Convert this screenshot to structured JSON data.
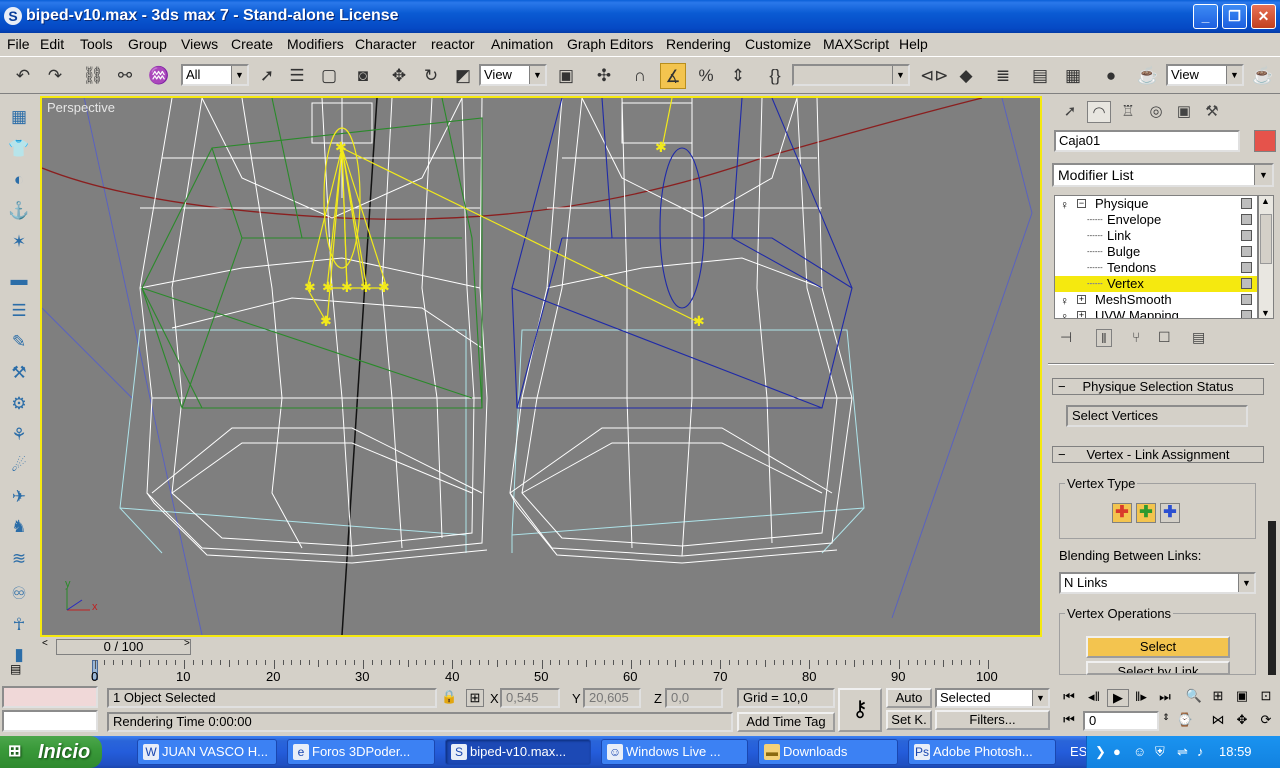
{
  "window": {
    "title": "biped-v10.max - 3ds max 7  - Stand-alone License",
    "app_icon": "3ds-max-icon",
    "controls": {
      "minimize": "_",
      "maximize": "❐",
      "close": "✕"
    }
  },
  "menu": [
    "File",
    "Edit",
    "Tools",
    "Group",
    "Views",
    "Create",
    "Modifiers",
    "Character",
    "reactor",
    "Animation",
    "Graph Editors",
    "Rendering",
    "Customize",
    "MAXScript",
    "Help"
  ],
  "toolbar": {
    "selection_filter": "All",
    "ref_coord": "View",
    "named_selection": "",
    "view_dropdown": "View"
  },
  "viewport": {
    "label": "Perspective",
    "axis_x": "x",
    "axis_y": "y"
  },
  "command_panel": {
    "object_name": "Caja01",
    "object_color": "#e5534b",
    "modifier_list": "Modifier List",
    "stack": [
      {
        "label": "Physique",
        "level": 0
      },
      {
        "label": "Envelope",
        "level": 1
      },
      {
        "label": "Link",
        "level": 1
      },
      {
        "label": "Bulge",
        "level": 1
      },
      {
        "label": "Tendons",
        "level": 1
      },
      {
        "label": "Vertex",
        "level": 1,
        "selected": true
      },
      {
        "label": "MeshSmooth",
        "level": 0
      },
      {
        "label": "UVW Mapping",
        "level": 0
      }
    ],
    "rollout_selection_status": {
      "title": "Physique Selection Status",
      "status": "Select Vertices"
    },
    "rollout_vertex_link": {
      "title": "Vertex - Link Assignment",
      "vertex_type_label": "Vertex Type",
      "vertex_type_colors": [
        "#d93a2b",
        "#2e9a2e",
        "#2b4fd1"
      ],
      "blending_label": "Blending Between Links:",
      "blending_value": "N Links",
      "operations_label": "Vertex Operations",
      "select_button": "Select",
      "select_by_link_button": "Select by Link"
    }
  },
  "timeline": {
    "frame_display": "0 / 100",
    "tick_labels": [
      "0",
      "10",
      "20",
      "30",
      "40",
      "50",
      "60",
      "70",
      "80",
      "90",
      "100"
    ]
  },
  "status": {
    "selection": "1 Object Selected",
    "rendering_time": "Rendering Time  0:00:00",
    "x_label": "X",
    "x_value": "0,545",
    "y_label": "Y",
    "y_value": "20,605",
    "z_label": "Z",
    "z_value": "0,0",
    "grid": "Grid = 10,0",
    "add_time_tag": "Add Time Tag",
    "auto_key": "Auto",
    "set_key": "Set K.",
    "key_filter": "Selected",
    "filters": "Filters...",
    "current_frame": "0"
  },
  "taskbar": {
    "start": "Inicio",
    "items": [
      {
        "label": "JUAN VASCO H...",
        "icon": "word-icon"
      },
      {
        "label": "Foros 3DPoder...",
        "icon": "ie-icon"
      },
      {
        "label": "biped-v10.max...",
        "icon": "3ds-max-icon",
        "active": true
      },
      {
        "label": "Windows Live ...",
        "icon": "messenger-icon"
      },
      {
        "label": "Downloads",
        "icon": "folder-icon"
      },
      {
        "label": "Adobe Photosh...",
        "icon": "photoshop-icon"
      }
    ],
    "language": "ES",
    "clock": "18:59"
  }
}
